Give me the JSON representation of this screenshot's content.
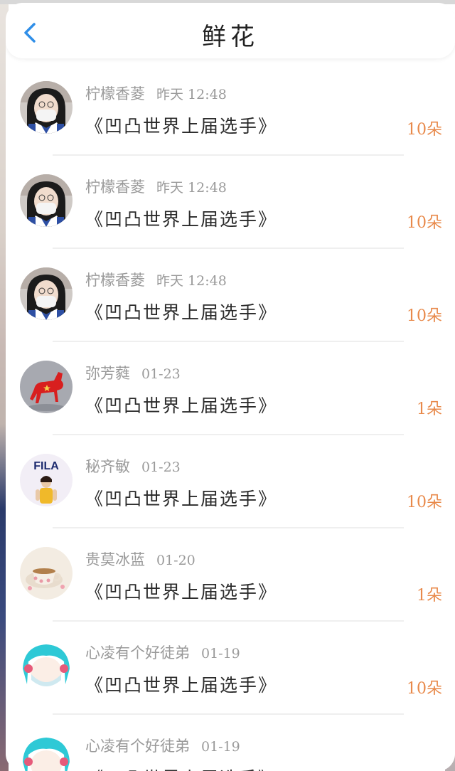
{
  "header": {
    "title": "鲜花",
    "back_icon": "chevron-left-icon",
    "accent_color": "#2f8ee8"
  },
  "colors": {
    "amount": "#e8894a",
    "name": "#9a9a9a",
    "title": "#2a2a2a"
  },
  "items": [
    {
      "name": "柠檬香菱",
      "time": "昨天 12:48",
      "title": "《凹凸世界上届选手》",
      "amount": "10朵",
      "avatar": "girl-mask-avatar"
    },
    {
      "name": "柠檬香菱",
      "time": "昨天 12:48",
      "title": "《凹凸世界上届选手》",
      "amount": "10朵",
      "avatar": "girl-mask-avatar"
    },
    {
      "name": "柠檬香菱",
      "time": "昨天 12:48",
      "title": "《凹凸世界上届选手》",
      "amount": "10朵",
      "avatar": "girl-mask-avatar"
    },
    {
      "name": "弥芳蕤",
      "time": "01-23",
      "title": "《凹凸世界上届选手》",
      "amount": "1朵",
      "avatar": "red-horse-avatar"
    },
    {
      "name": "秘齐敏",
      "time": "01-23",
      "title": "《凹凸世界上届选手》",
      "amount": "10朵",
      "avatar": "fila-girl-avatar"
    },
    {
      "name": "贵莫冰蓝",
      "time": "01-20",
      "title": "《凹凸世界上届选手》",
      "amount": "1朵",
      "avatar": "teacup-avatar"
    },
    {
      "name": "心凌有个好徒弟",
      "time": "01-19",
      "title": "《凹凸世界上届选手》",
      "amount": "10朵",
      "avatar": "anime-cyan-hair-avatar"
    },
    {
      "name": "心凌有个好徒弟",
      "time": "01-19",
      "title": "《凹凸世界上届选手》",
      "amount": "",
      "avatar": "anime-cyan-hair-avatar"
    }
  ]
}
